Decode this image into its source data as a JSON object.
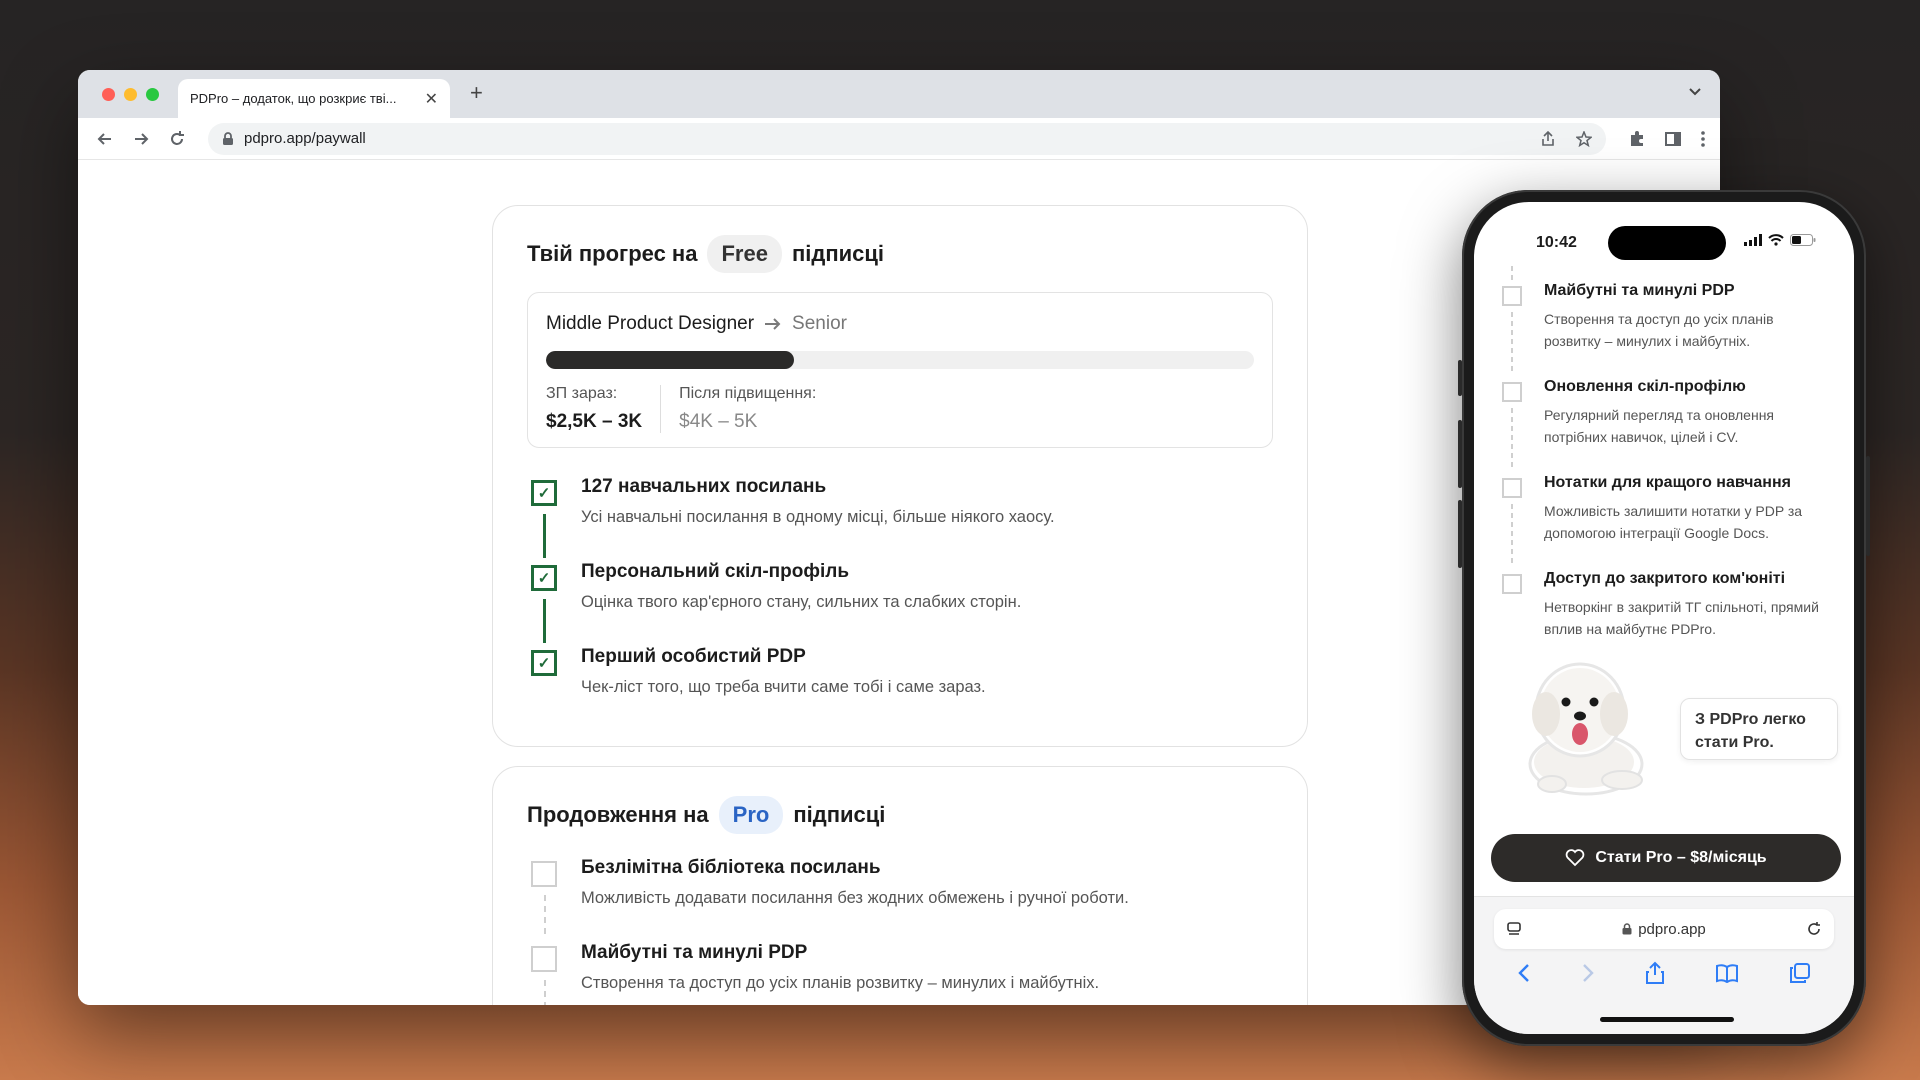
{
  "browser": {
    "tab_title": "PDPro – додаток, що розкриє тві...",
    "url": "pdpro.app/paywall"
  },
  "free_card": {
    "title_before": "Твій прогрес на",
    "plan": "Free",
    "title_after": "підписці",
    "career": {
      "current_role": "Middle Product Designer",
      "target_role": "Senior",
      "progress_fraction": 0.35,
      "salary_now_label": "ЗП зараз:",
      "salary_now": "$2,5K – 3K",
      "salary_after_label": "Після підвищення:",
      "salary_after": "$4K – 5K"
    },
    "steps": [
      {
        "title": "127 навчальних посилань",
        "desc": "Усі навчальні посилання в одному місці, більше ніякого хаосу."
      },
      {
        "title": "Персональний скіл-профіль",
        "desc": "Оцінка твого кар'єрного стану, сильних та слабких сторін."
      },
      {
        "title": "Перший особистий PDP",
        "desc": "Чек-ліст того, що треба вчити саме тобі і саме зараз."
      }
    ]
  },
  "pro_card": {
    "title_before": "Продовження на",
    "plan": "Pro",
    "title_after": "підписці",
    "steps": [
      {
        "title": "Безлімітна бібліотека посилань",
        "desc": "Можливість додавати посилання без жодних обмежень і ручної роботи."
      },
      {
        "title": "Майбутні та минулі PDP",
        "desc": "Створення та доступ до усіх планів розвитку – минулих і майбутніх."
      }
    ]
  },
  "phone": {
    "time": "10:42",
    "steps": [
      {
        "title": "Майбутні та минулі PDP",
        "desc": "Створення та доступ до усіх планів розвитку – минулих і майбутніх."
      },
      {
        "title": "Оновлення скіл-профілю",
        "desc": "Регулярний перегляд та оновлення потрібних навичок, цілей і CV."
      },
      {
        "title": "Нотатки для кращого навчання",
        "desc": "Можливість залишити нотатки у PDP за допомогою інтеграції Google Docs."
      },
      {
        "title": "Доступ до закритого ком'юніті",
        "desc": "Нетворкінг в закритій  ТГ спільноті, прямий вплив на майбутнє PDPro."
      }
    ],
    "bubble": "З PDPro легко стати Pro.",
    "cta": "Стати Pro – $8/місяць",
    "safari_url": "pdpro.app"
  },
  "colors": {
    "accent_green": "#1f6b3a",
    "pro_blue": "#2a64c4",
    "dark_button": "#2d2b29"
  }
}
